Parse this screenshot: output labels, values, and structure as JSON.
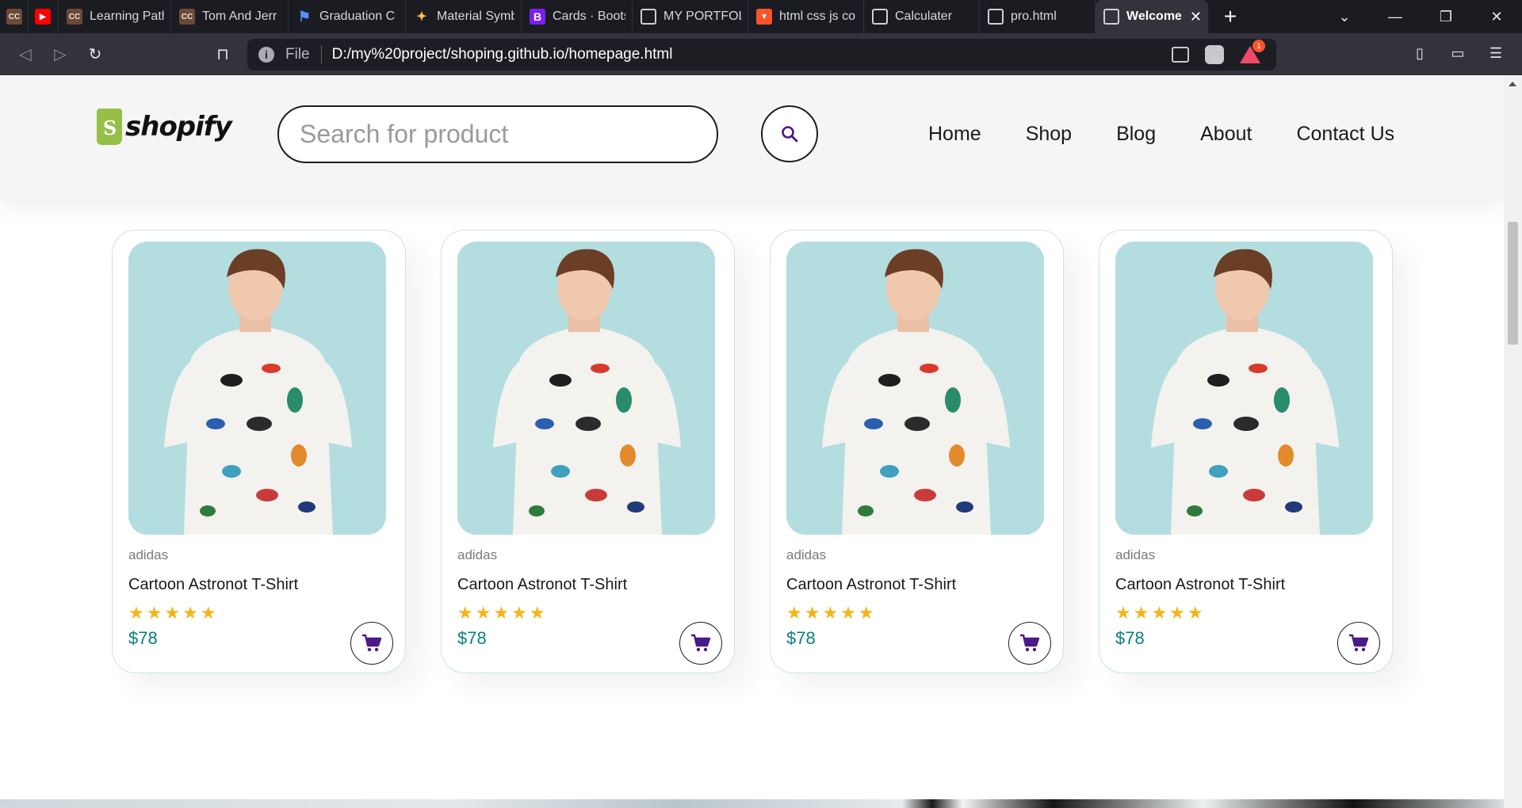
{
  "browser": {
    "tabs": [
      {
        "label": "",
        "icon": "cc-icon"
      },
      {
        "label": "",
        "icon": "youtube-icon"
      },
      {
        "label": "Learning Path",
        "icon": "cc-icon"
      },
      {
        "label": "Tom And Jerr",
        "icon": "cc-icon"
      },
      {
        "label": "Graduation C",
        "icon": "flag-icon"
      },
      {
        "label": "Material Symb",
        "icon": "material-symbols-icon"
      },
      {
        "label": "Cards · Bootst",
        "icon": "bootstrap-icon"
      },
      {
        "label": "MY PORTFOLI",
        "icon": "globe-icon"
      },
      {
        "label": "html css js co",
        "icon": "brave-icon"
      },
      {
        "label": "Calculater",
        "icon": "globe-icon"
      },
      {
        "label": "pro.html",
        "icon": "globe-icon"
      },
      {
        "label": "Welcome",
        "icon": "globe-icon",
        "active": true
      }
    ],
    "address": {
      "scheme": "File",
      "url": "D:/my%20project/shoping.github.io/homepage.html"
    },
    "rewards_badge": "1"
  },
  "site": {
    "logo_text": "shopify",
    "search": {
      "placeholder": "Search for product",
      "value": ""
    },
    "nav": [
      "Home",
      "Shop",
      "Blog",
      "About",
      "Contact Us"
    ],
    "products": [
      {
        "brand": "adidas",
        "title": "Cartoon Astronot T-Shirt",
        "rating": 5,
        "stars": "★★★★★",
        "price": "$78"
      },
      {
        "brand": "adidas",
        "title": "Cartoon Astronot T-Shirt",
        "rating": 5,
        "stars": "★★★★★",
        "price": "$78"
      },
      {
        "brand": "adidas",
        "title": "Cartoon Astronot T-Shirt",
        "rating": 5,
        "stars": "★★★★★",
        "price": "$78"
      },
      {
        "brand": "adidas",
        "title": "Cartoon Astronot T-Shirt",
        "rating": 5,
        "stars": "★★★★★",
        "price": "$78"
      }
    ]
  },
  "colors": {
    "accent": "#088178",
    "star": "#f3b519",
    "icon_purple": "#4a1a8a",
    "logo_green": "#95bf47",
    "card_border": "#cce7d0",
    "product_bg": "#b4dde0"
  }
}
